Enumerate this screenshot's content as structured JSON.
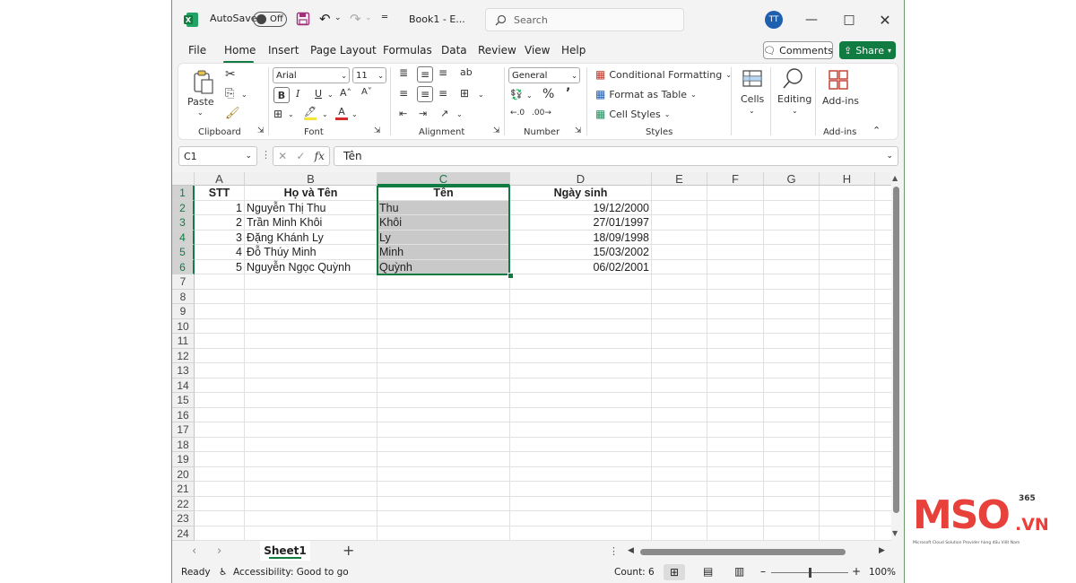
{
  "titlebar": {
    "autosave_label": "AutoSave",
    "autosave_state": "Off",
    "file_name": "Book1  -  E...",
    "search_placeholder": "Search",
    "user_initials": "TT"
  },
  "menu": {
    "tabs": [
      "File",
      "Home",
      "Insert",
      "Page Layout",
      "Formulas",
      "Data",
      "Review",
      "View",
      "Help"
    ],
    "active_tab": "Home",
    "comments_label": "Comments",
    "share_label": "Share"
  },
  "ribbon": {
    "clipboard": {
      "label": "Clipboard",
      "paste_label": "Paste"
    },
    "font": {
      "label": "Font",
      "font_name": "Arial",
      "font_size": "11"
    },
    "alignment": {
      "label": "Alignment"
    },
    "number": {
      "label": "Number",
      "format": "General"
    },
    "styles": {
      "label": "Styles",
      "conditional_formatting": "Conditional Formatting",
      "format_as_table": "Format as Table",
      "cell_styles": "Cell Styles"
    },
    "cells": {
      "label": "Cells"
    },
    "editing": {
      "label": "Editing"
    },
    "addins": {
      "label": "Add-ins",
      "group_label": "Add-ins"
    }
  },
  "formula_bar": {
    "name_box": "C1",
    "fx_symbol": "fx",
    "content": "Tên"
  },
  "sheet": {
    "columns": [
      "A",
      "B",
      "C",
      "D",
      "E",
      "F",
      "G",
      "H"
    ],
    "selected_column": "C",
    "rows": [
      "1",
      "2",
      "3",
      "4",
      "5",
      "6",
      "7",
      "8",
      "9",
      "10",
      "11",
      "12",
      "13",
      "14",
      "15",
      "16",
      "17",
      "18",
      "19",
      "20",
      "21",
      "22",
      "23",
      "24"
    ],
    "headers": {
      "A": "STT",
      "B": "Họ và Tên",
      "C": "Tên",
      "D": "Ngày sinh"
    },
    "data": [
      {
        "stt": "1",
        "full_name": "Nguyễn Thị Thu",
        "name": "Thu",
        "dob": "19/12/2000"
      },
      {
        "stt": "2",
        "full_name": "Trần Minh Khôi",
        "name": "Khôi",
        "dob": "27/01/1997"
      },
      {
        "stt": "3",
        "full_name": "Đặng Khánh Ly",
        "name": "Ly",
        "dob": "18/09/1998"
      },
      {
        "stt": "4",
        "full_name": "Đỗ Thúy Minh",
        "name": "Minh",
        "dob": "15/03/2002"
      },
      {
        "stt": "5",
        "full_name": "Nguyễn Ngọc Quỳnh",
        "name": "Quỳnh",
        "dob": "06/02/2001"
      }
    ]
  },
  "sheet_tabs": {
    "active": "Sheet1"
  },
  "status": {
    "ready": "Ready",
    "accessibility": "Accessibility: Good to go",
    "count": "Count: 6",
    "zoom": "100%",
    "zoom_level": 1.0
  },
  "watermark": {
    "brand": "MSO",
    "suffix": ".VN",
    "superscript": "365",
    "tagline": "Microsoft Cloud Solution Provider hàng đầu Việt Nam"
  },
  "colors": {
    "accent": "#107c41",
    "brand_red": "#e8403a",
    "selection_fill": "#c9c9c9"
  }
}
